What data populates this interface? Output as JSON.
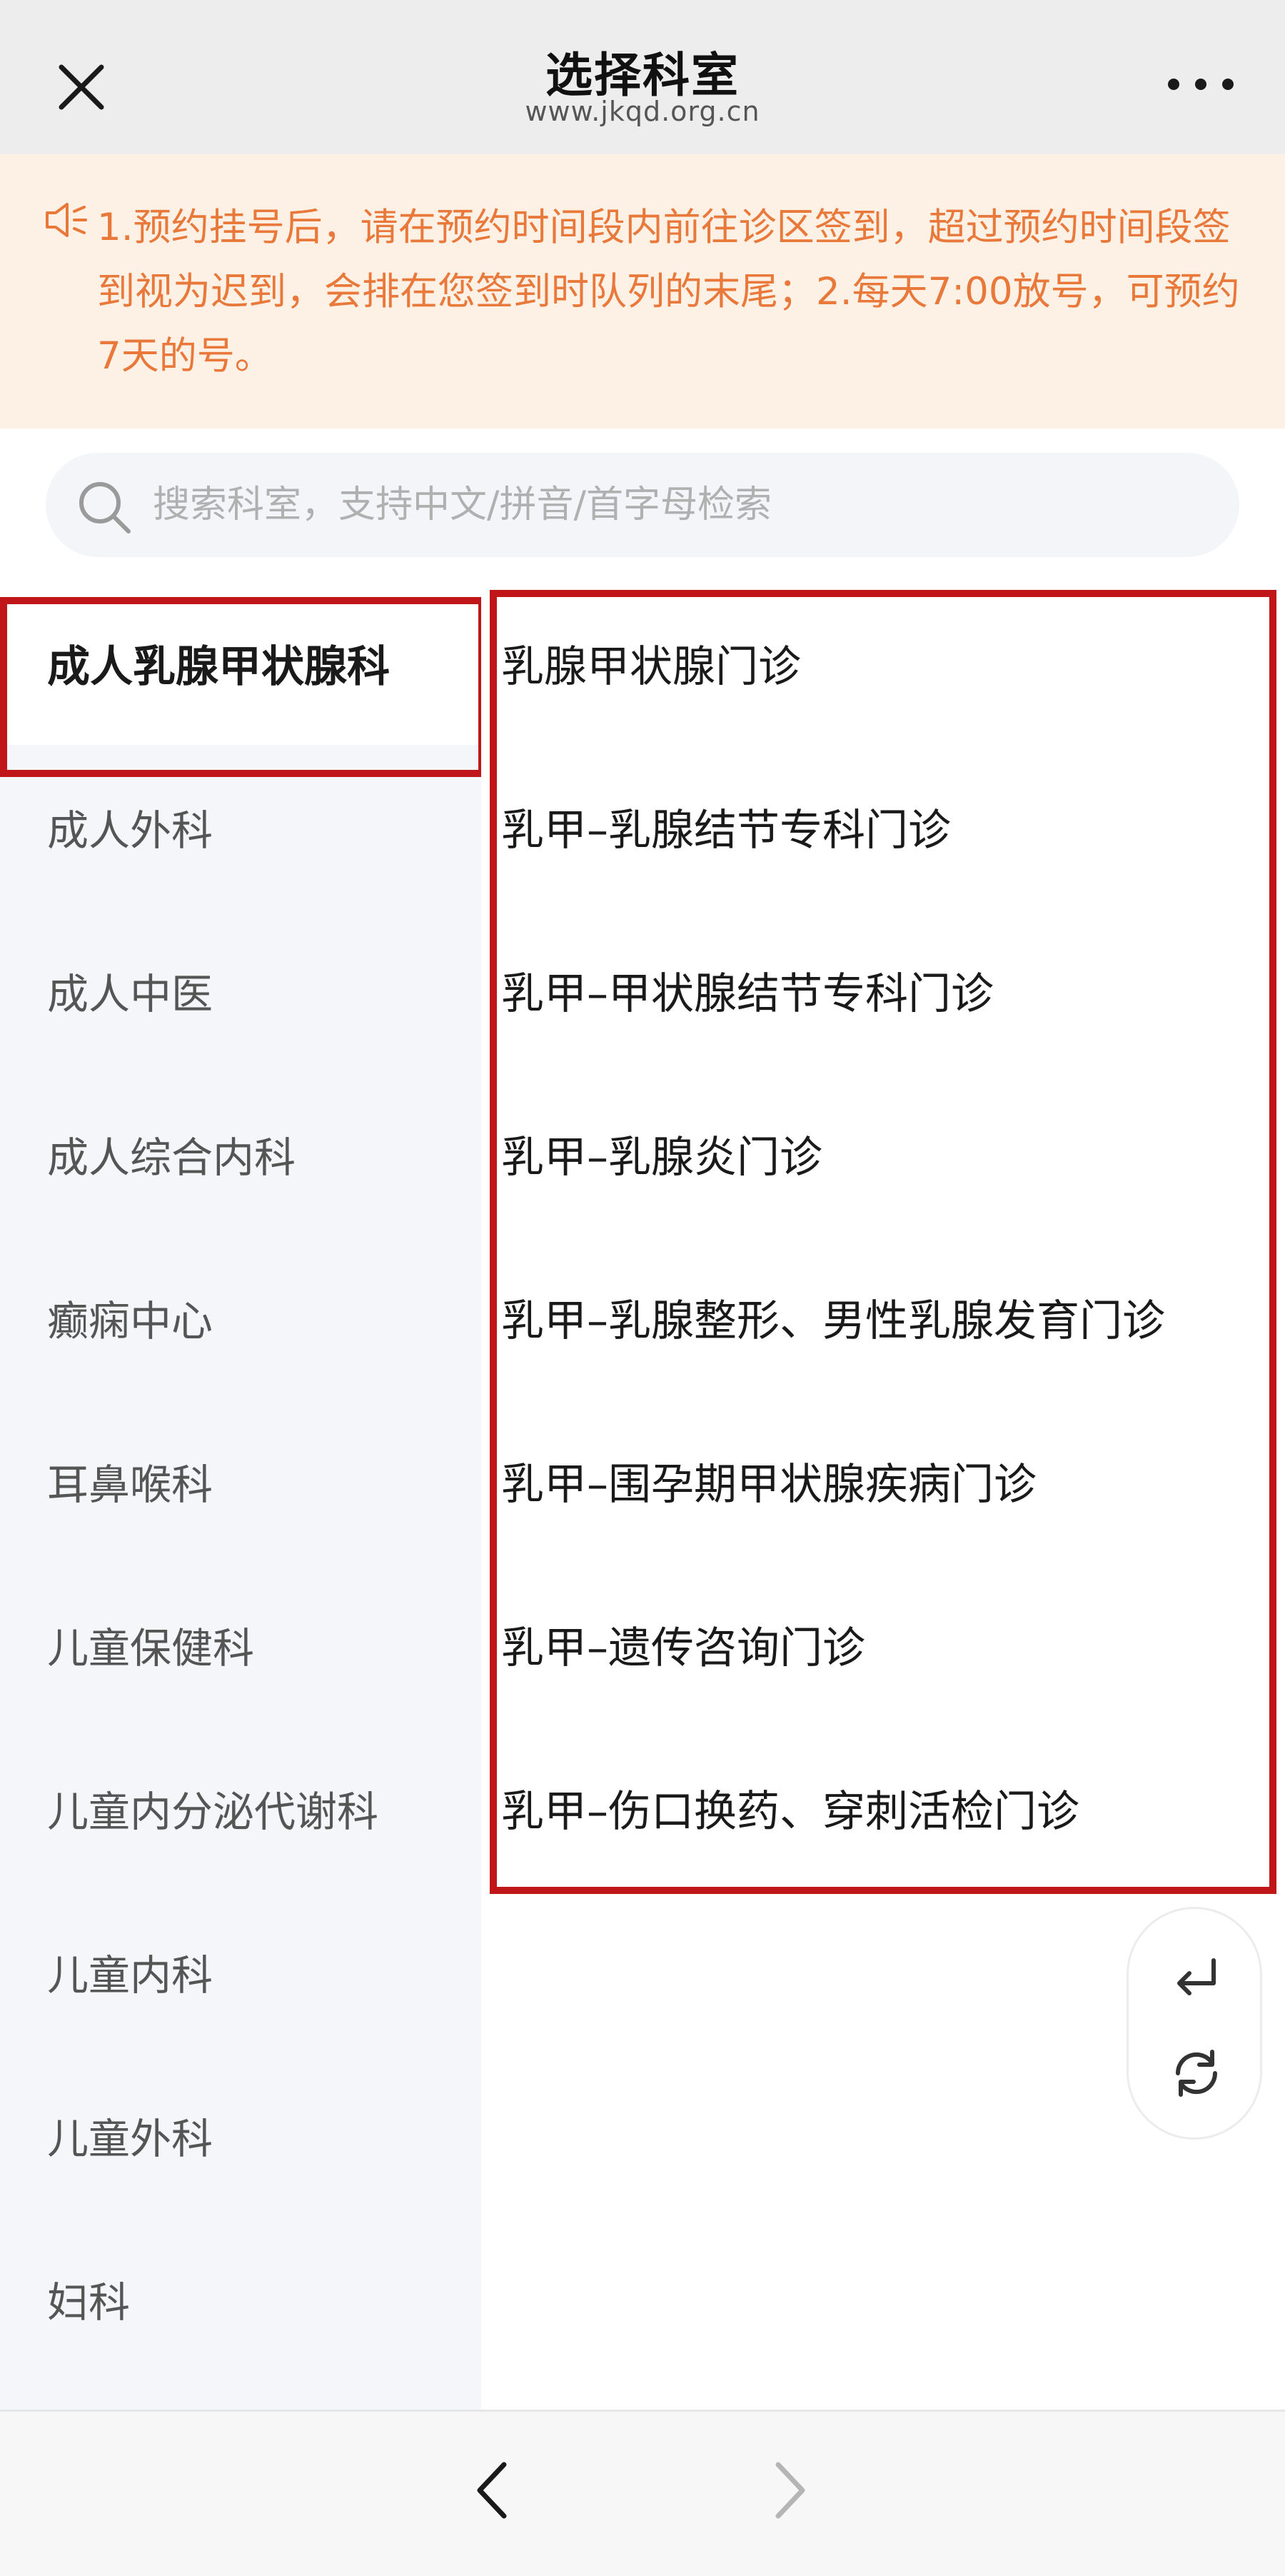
{
  "header": {
    "title": "选择科室",
    "url": "www.jkqd.org.cn",
    "close_icon": "close-icon",
    "more_icon": "more-icon"
  },
  "notice": {
    "icon": "speaker-icon",
    "text": "1.预约挂号后，请在预约时间段内前往诊区签到，超过预约时间段签到视为迟到，会排在您签到时队列的末尾；2.每天7:00放号，可预约7天的号。"
  },
  "search": {
    "placeholder": "搜索科室，支持中文/拼音/首字母检索",
    "value": ""
  },
  "sidebar": {
    "items": [
      {
        "label": "成人乳腺甲状腺科",
        "active": true
      },
      {
        "label": "成人外科"
      },
      {
        "label": "成人中医"
      },
      {
        "label": "成人综合内科"
      },
      {
        "label": "癫痫中心"
      },
      {
        "label": "耳鼻喉科"
      },
      {
        "label": "儿童保健科"
      },
      {
        "label": "儿童内分泌代谢科"
      },
      {
        "label": "儿童内科"
      },
      {
        "label": "儿童外科"
      },
      {
        "label": "妇科"
      }
    ]
  },
  "clinics": {
    "items": [
      {
        "label": "乳腺甲状腺门诊"
      },
      {
        "label": "乳甲–乳腺结节专科门诊"
      },
      {
        "label": "乳甲–甲状腺结节专科门诊"
      },
      {
        "label": "乳甲–乳腺炎门诊"
      },
      {
        "label": "乳甲–乳腺整形、男性乳腺发育门诊"
      },
      {
        "label": "乳甲–围孕期甲状腺疾病门诊"
      },
      {
        "label": "乳甲–遗传咨询门诊"
      },
      {
        "label": "乳甲–伤口换药、穿刺活检门诊"
      }
    ]
  },
  "float_buttons": [
    "return-icon",
    "refresh-icon"
  ],
  "bottom_nav": [
    "back-arrow-icon",
    "forward-arrow-icon"
  ],
  "colors": {
    "notice_text": "#e8793a",
    "notice_bg": "#fdf1e6",
    "highlight": "#c0161a",
    "sidebar_bg": "#f5f6f9"
  }
}
